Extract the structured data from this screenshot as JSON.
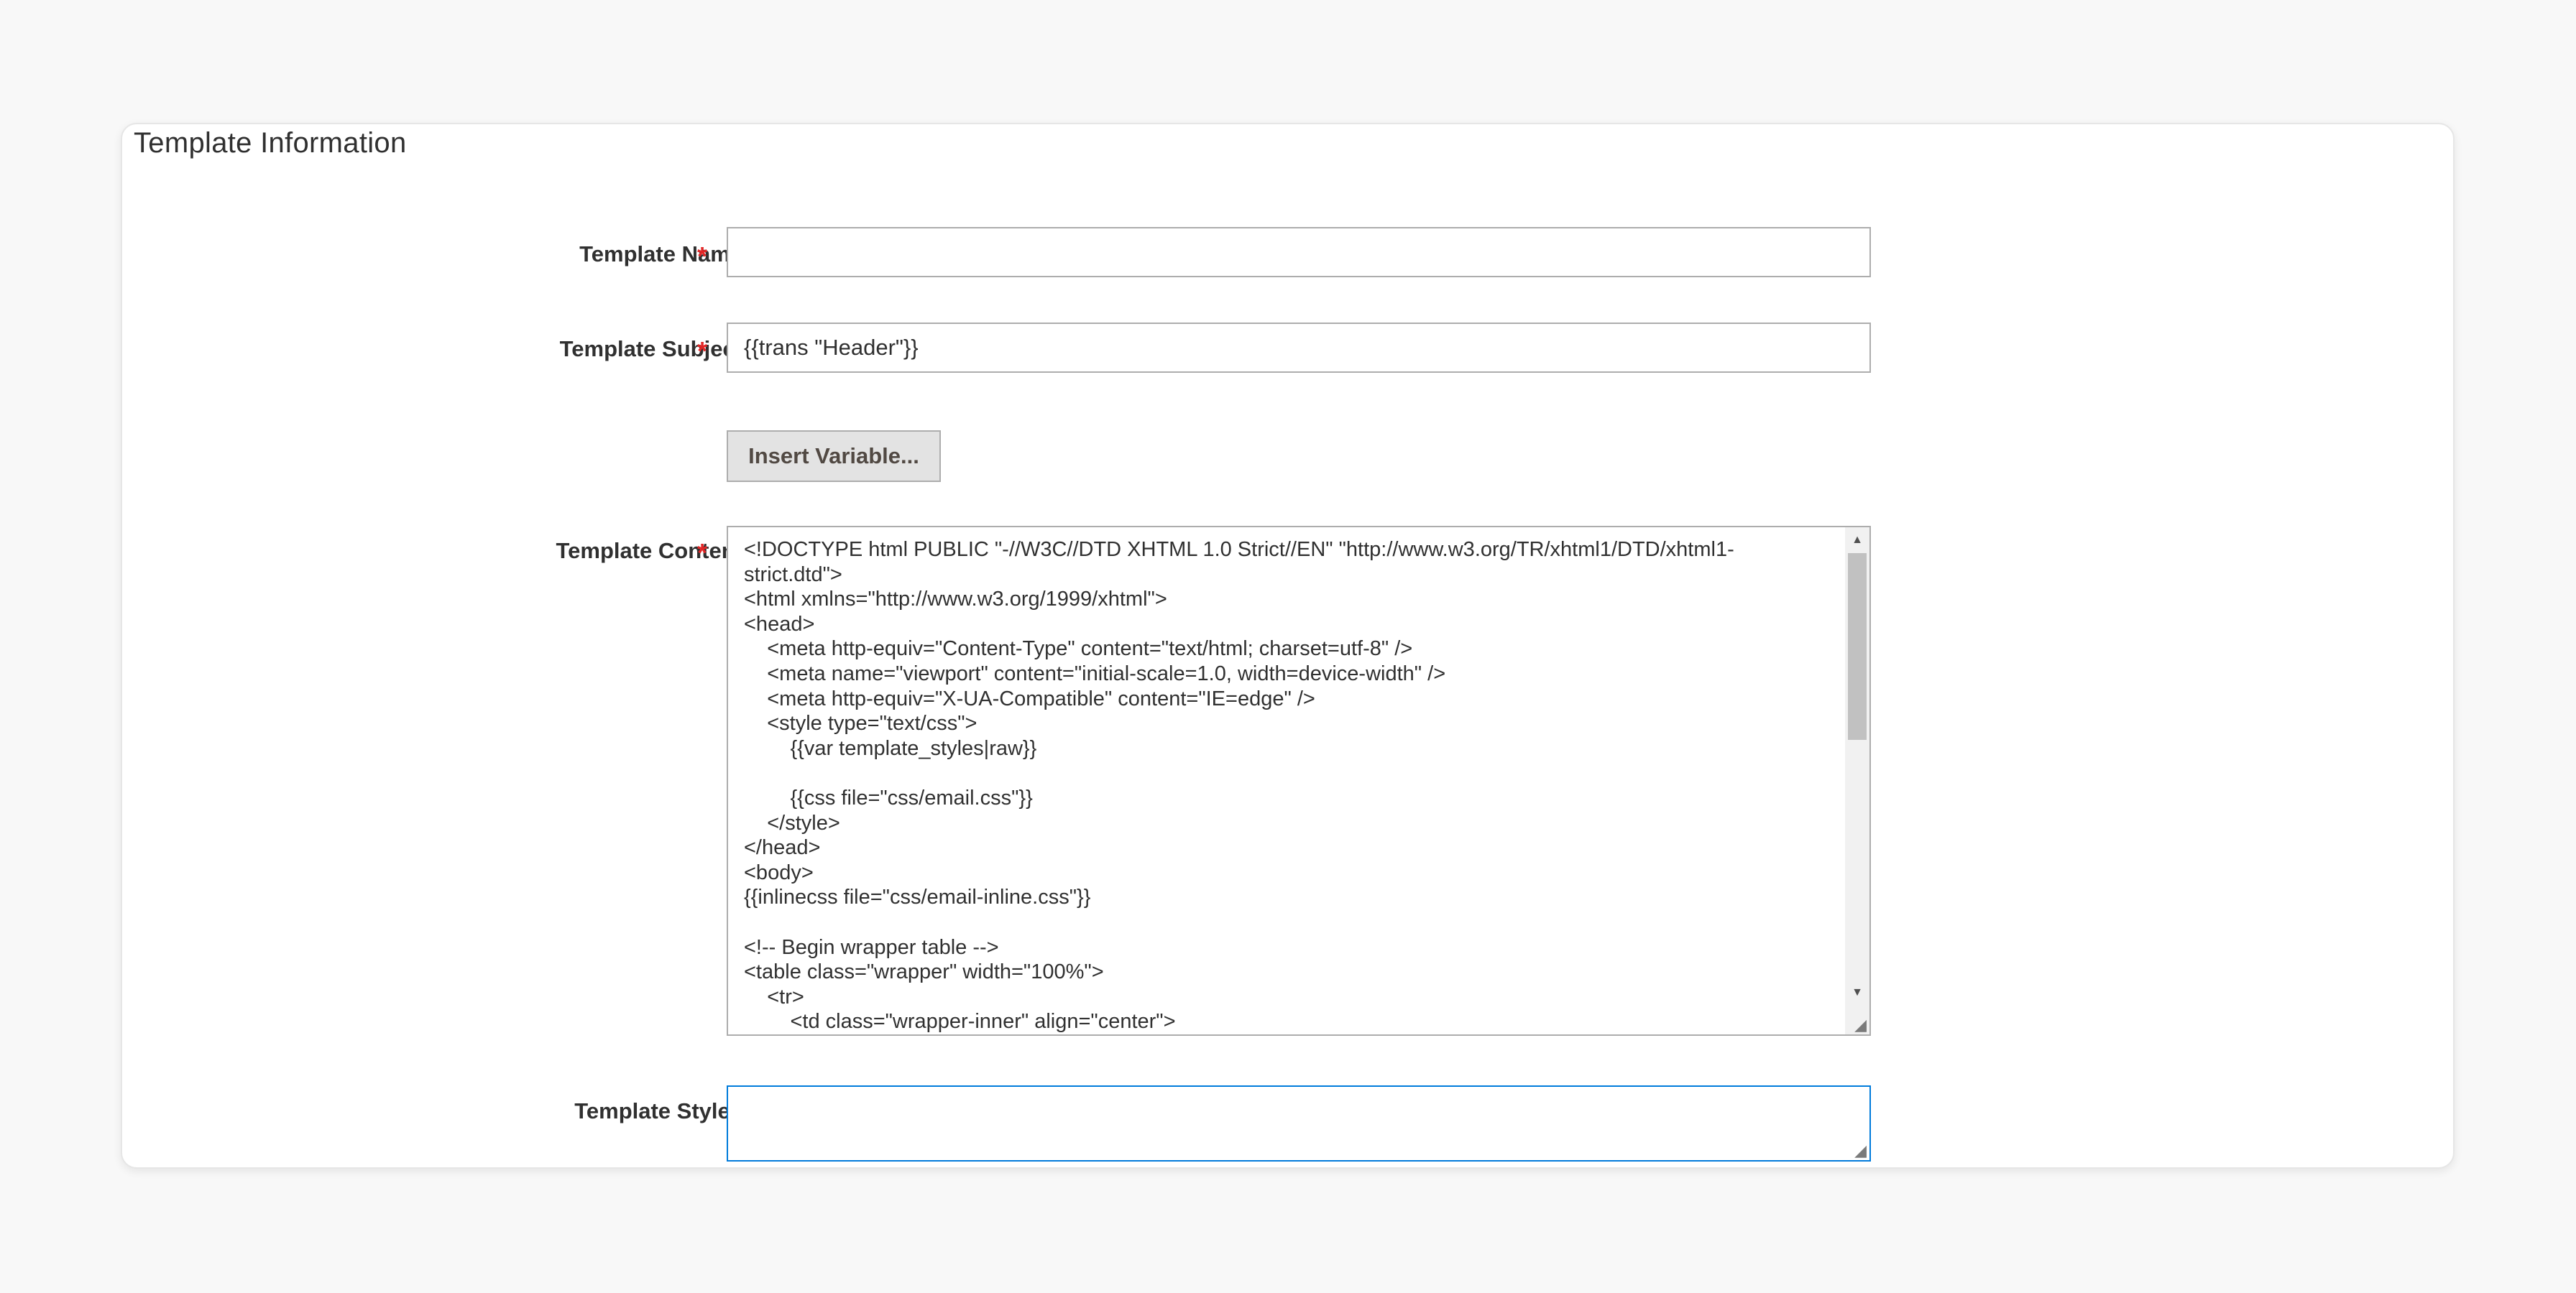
{
  "section": {
    "title": "Template Information"
  },
  "form": {
    "template_name": {
      "label": "Template Name",
      "required_marker": "*",
      "value": ""
    },
    "template_subject": {
      "label": "Template Subject",
      "required_marker": "*",
      "value": "{{trans \"Header\"}}"
    },
    "insert_variable_button": "Insert Variable...",
    "template_content": {
      "label": "Template Content",
      "required_marker": "*",
      "lines": [
        "<!DOCTYPE html PUBLIC \"-//W3C//DTD XHTML 1.0 Strict//EN\" \"http://www.w3.org/TR/xhtml1/DTD/xhtml1-",
        "strict.dtd\">",
        "<html xmlns=\"http://www.w3.org/1999/xhtml\">",
        "<head>",
        "    <meta http-equiv=\"Content-Type\" content=\"text/html; charset=utf-8\" />",
        "    <meta name=\"viewport\" content=\"initial-scale=1.0, width=device-width\" />",
        "    <meta http-equiv=\"X-UA-Compatible\" content=\"IE=edge\" />",
        "    <style type=\"text/css\">",
        "        {{var template_styles|raw}}",
        "",
        "        {{css file=\"css/email.css\"}}",
        "    </style>",
        "</head>",
        "<body>",
        "{{inlinecss file=\"css/email-inline.css\"}}",
        "",
        "<!-- Begin wrapper table -->",
        "<table class=\"wrapper\" width=\"100%\">",
        "    <tr>",
        "        <td class=\"wrapper-inner\" align=\"center\">"
      ]
    },
    "template_styles": {
      "label": "Template Styles",
      "value": ""
    }
  },
  "icons": {
    "scroll_up": "scroll-up-arrow-icon",
    "scroll_down": "scroll-down-arrow-icon",
    "resize": "resize-grip-icon"
  },
  "colors": {
    "required": "#e22626",
    "focus_border": "#007bdb",
    "button_bg": "#e3e3e3"
  }
}
